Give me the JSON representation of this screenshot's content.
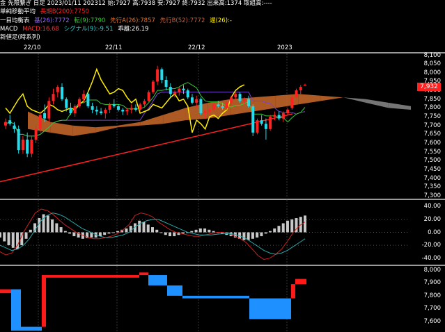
{
  "header": {
    "line1": "金 先限繋ぎ 日足 2023/01/11 202312 始:7927 高:7938 安:7927 終:7932 出来高:1374 取組高:----",
    "ma_label": "単純移動平均",
    "ma_value": "長期B(200):7750",
    "ichimoku_label": "一目均衡表",
    "ichimoku_base": "基(26):7772",
    "ichimoku_conv": "転(9):7790",
    "ichimoku_span_a": "先行A(26):7857",
    "ichimoku_span_b": "先行B(52):7772",
    "ichimoku_lag": "遅(26):-",
    "macd_label": "MACD",
    "macd_value": "MACD:16.68",
    "macd_signal": "シグナル(9):-9.51",
    "macd_hist": "乖離:26.19",
    "newvalue_label": "新値足(時系列)"
  },
  "xaxis": [
    "22/10",
    "22/11",
    "22/12",
    "2023"
  ],
  "price_axis": [
    "8,100",
    "8,050",
    "8,000",
    "7,950",
    "7,900",
    "7,850",
    "7,800",
    "7,750",
    "7,700",
    "7,650",
    "7,600",
    "7,550",
    "7,500",
    "7,450",
    "7,400",
    "7,350",
    "7,300"
  ],
  "macd_axis": [
    "40.00",
    "20.00",
    "0.00",
    "-20.00",
    "-40.00"
  ],
  "newvalue_axis": [
    "8,000",
    "7,900",
    "7,800",
    "7,700",
    "7,600"
  ],
  "current_price": "7,932",
  "colors": {
    "up": "#ff2222",
    "down": "#22ddee",
    "ma": "#ff2020",
    "conv": "#7744cc",
    "base": "#ffee00",
    "span_up": "#cc6a2a",
    "span_down": "#8a8a8a",
    "macd": "#cc2020",
    "signal": "#2aa8a8",
    "hist": "#c8c8c8"
  },
  "chart_data": [
    {
      "type": "candlestick",
      "title": "金 先限繋ぎ 日足",
      "ylim": [
        7280,
        8110
      ],
      "x": [
        "22/10",
        "22/11",
        "22/12",
        "2023"
      ],
      "candles": [
        [
          7700,
          7740,
          7680,
          7720
        ],
        [
          7730,
          7760,
          7700,
          7710
        ],
        [
          7700,
          7720,
          7660,
          7680
        ],
        [
          7680,
          7700,
          7540,
          7560
        ],
        [
          7560,
          7640,
          7540,
          7620
        ],
        [
          7620,
          7660,
          7520,
          7540
        ],
        [
          7540,
          7640,
          7520,
          7620
        ],
        [
          7620,
          7700,
          7600,
          7680
        ],
        [
          7680,
          7780,
          7660,
          7760
        ],
        [
          7770,
          7820,
          7720,
          7740
        ],
        [
          7740,
          7860,
          7720,
          7840
        ],
        [
          7840,
          7910,
          7820,
          7880
        ],
        [
          7890,
          7930,
          7860,
          7920
        ],
        [
          7920,
          7940,
          7840,
          7850
        ],
        [
          7850,
          7860,
          7780,
          7800
        ],
        [
          7800,
          7830,
          7760,
          7770
        ],
        [
          7770,
          7820,
          7750,
          7810
        ],
        [
          7810,
          7860,
          7800,
          7850
        ],
        [
          7850,
          7900,
          7830,
          7880
        ],
        [
          7880,
          7890,
          7800,
          7810
        ],
        [
          7810,
          7830,
          7770,
          7790
        ],
        [
          7790,
          7810,
          7760,
          7780
        ],
        [
          7780,
          7800,
          7760,
          7770
        ],
        [
          7770,
          7800,
          7740,
          7790
        ],
        [
          7790,
          7830,
          7770,
          7820
        ],
        [
          7820,
          7850,
          7800,
          7810
        ],
        [
          7810,
          7820,
          7780,
          7790
        ],
        [
          7790,
          7800,
          7760,
          7780
        ],
        [
          7780,
          7800,
          7760,
          7790
        ],
        [
          7790,
          7820,
          7770,
          7800
        ],
        [
          7800,
          7820,
          7780,
          7790
        ],
        [
          7790,
          7830,
          7780,
          7820
        ],
        [
          7820,
          7850,
          7800,
          7840
        ],
        [
          7840,
          7900,
          7830,
          7890
        ],
        [
          7890,
          7960,
          7880,
          7950
        ],
        [
          7950,
          8040,
          7930,
          8020
        ],
        [
          8020,
          8030,
          7940,
          7960
        ],
        [
          7960,
          7980,
          7900,
          7920
        ],
        [
          7920,
          7940,
          7860,
          7880
        ],
        [
          7880,
          7900,
          7860,
          7890
        ],
        [
          7890,
          7920,
          7870,
          7910
        ],
        [
          7910,
          7930,
          7880,
          7900
        ],
        [
          7900,
          7910,
          7850,
          7860
        ],
        [
          7860,
          7880,
          7820,
          7830
        ],
        [
          7830,
          7870,
          7800,
          7850
        ],
        [
          7850,
          7860,
          7760,
          7770
        ],
        [
          7770,
          7790,
          7740,
          7780
        ],
        [
          7780,
          7800,
          7760,
          7790
        ],
        [
          7790,
          7830,
          7780,
          7820
        ],
        [
          7820,
          7840,
          7800,
          7810
        ],
        [
          7810,
          7830,
          7790,
          7800
        ],
        [
          7800,
          7840,
          7790,
          7830
        ],
        [
          7830,
          7870,
          7820,
          7860
        ],
        [
          7860,
          7890,
          7850,
          7880
        ],
        [
          7880,
          7890,
          7830,
          7840
        ],
        [
          7840,
          7860,
          7820,
          7850
        ],
        [
          7850,
          7870,
          7800,
          7810
        ],
        [
          7810,
          7820,
          7640,
          7660
        ],
        [
          7660,
          7740,
          7650,
          7730
        ],
        [
          7730,
          7760,
          7700,
          7710
        ],
        [
          7710,
          7740,
          7620,
          7680
        ],
        [
          7680,
          7760,
          7670,
          7750
        ],
        [
          7750,
          7780,
          7730,
          7760
        ],
        [
          7760,
          7780,
          7730,
          7740
        ],
        [
          7740,
          7780,
          7720,
          7770
        ],
        [
          7770,
          7800,
          7760,
          7790
        ],
        [
          7800,
          7870,
          7790,
          7860
        ],
        [
          7860,
          7910,
          7850,
          7900
        ],
        [
          7900,
          7930,
          7880,
          7920
        ],
        [
          7927,
          7938,
          7927,
          7932
        ]
      ],
      "ma200": [
        7380,
        7766
      ],
      "span_a": [
        7780,
        7720,
        7700,
        7690,
        7700,
        7720,
        7760,
        7800,
        7830,
        7850,
        7860,
        7870,
        7880,
        7870,
        7860,
        7830,
        7800,
        7790
      ],
      "span_b": [
        7680,
        7660,
        7640,
        7660,
        7690,
        7700,
        7710,
        7730,
        7740,
        7760,
        7780,
        7800,
        7820,
        7840,
        7860,
        7850,
        7830,
        7810
      ]
    },
    {
      "type": "bar",
      "title": "MACD",
      "ylim": [
        -50,
        50
      ],
      "hist": [
        -8,
        -14,
        -20,
        -24,
        -26,
        -20,
        -10,
        4,
        14,
        22,
        28,
        26,
        20,
        14,
        8,
        2,
        -2,
        -6,
        -8,
        -10,
        -9,
        -8,
        -8,
        -6,
        -4,
        -2,
        0,
        2,
        4,
        6,
        10,
        14,
        18,
        16,
        12,
        8,
        4,
        0,
        -4,
        -6,
        -6,
        -4,
        -2,
        0,
        2,
        4,
        6,
        6,
        4,
        2,
        0,
        -2,
        -4,
        -6,
        -8,
        -10,
        -12,
        -12,
        -10,
        -8,
        -6,
        -2,
        2,
        6,
        10,
        14,
        18,
        20,
        22,
        24,
        26
      ],
      "series": [
        {
          "name": "MACD",
          "values": [
            -30,
            -35,
            -32,
            -20,
            0,
            15,
            30,
            36,
            34,
            28,
            20,
            12,
            6,
            0,
            -4,
            -8,
            -10,
            -10,
            -8,
            -6,
            -2,
            4,
            12,
            26,
            30,
            28,
            24,
            16,
            10,
            4,
            0,
            -2,
            -4,
            -6,
            -6,
            -4,
            -2,
            0,
            0,
            -2,
            -6,
            -10,
            -16,
            -26,
            -36,
            -42,
            -40,
            -34,
            -26,
            -14,
            0,
            10,
            16
          ]
        },
        {
          "name": "シグナル(9)",
          "values": [
            -20,
            -24,
            -28,
            -26,
            -20,
            -10,
            4,
            18,
            26,
            30,
            28,
            24,
            18,
            12,
            6,
            2,
            -2,
            -6,
            -8,
            -8,
            -6,
            -4,
            0,
            8,
            14,
            18,
            20,
            20,
            16,
            12,
            8,
            4,
            0,
            -2,
            -4,
            -4,
            -4,
            -3,
            -2,
            -2,
            -3,
            -6,
            -10,
            -16,
            -22,
            -28,
            -32,
            -34,
            -32,
            -28,
            -22,
            -16,
            -10
          ]
        }
      ]
    },
    {
      "type": "bar",
      "title": "新値足(時系列)",
      "ylim": [
        7520,
        8030
      ],
      "boxes": [
        {
          "dir": "up",
          "x0": 0,
          "x1": 16,
          "lo": 7820,
          "hi": 7850
        },
        {
          "dir": "down",
          "x0": 16,
          "x1": 30,
          "lo": 7530,
          "hi": 7850
        },
        {
          "dir": "down",
          "x0": 30,
          "x1": 60,
          "lo": 7530,
          "hi": 7560
        },
        {
          "dir": "up",
          "x0": 60,
          "x1": 66,
          "lo": 7560,
          "hi": 7960
        },
        {
          "dir": "up",
          "x0": 66,
          "x1": 200,
          "lo": 7940,
          "hi": 7960
        },
        {
          "dir": "up",
          "x0": 200,
          "x1": 213,
          "lo": 7960,
          "hi": 7980
        },
        {
          "dir": "down",
          "x0": 213,
          "x1": 240,
          "lo": 7880,
          "hi": 7960
        },
        {
          "dir": "down",
          "x0": 240,
          "x1": 262,
          "lo": 7800,
          "hi": 7880
        },
        {
          "dir": "down",
          "x0": 262,
          "x1": 358,
          "lo": 7780,
          "hi": 7800
        },
        {
          "dir": "down",
          "x0": 358,
          "x1": 418,
          "lo": 7620,
          "hi": 7780
        },
        {
          "dir": "up",
          "x0": 418,
          "x1": 424,
          "lo": 7780,
          "hi": 7890
        },
        {
          "dir": "up",
          "x0": 424,
          "x1": 440,
          "lo": 7890,
          "hi": 7930
        }
      ]
    }
  ]
}
